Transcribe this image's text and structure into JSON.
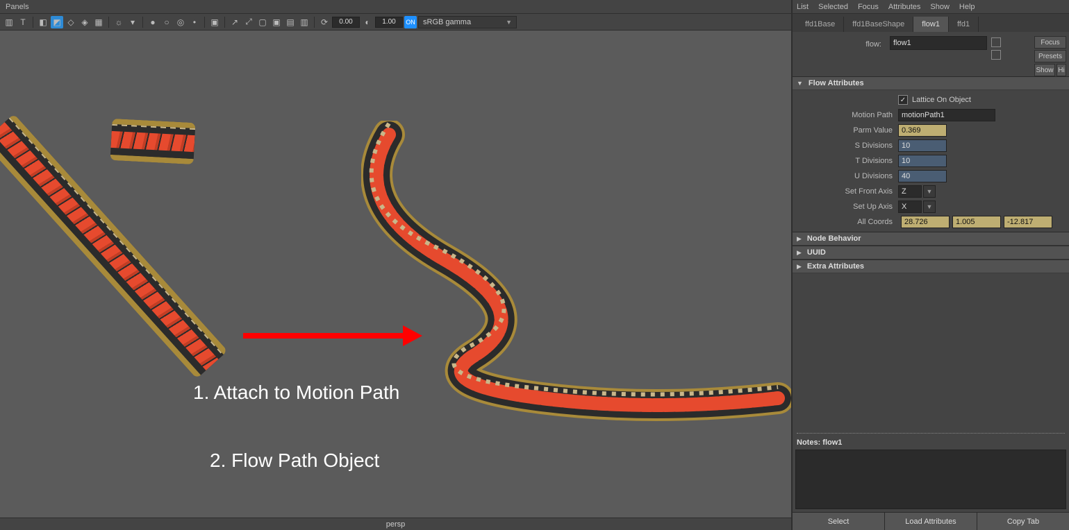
{
  "viewport": {
    "menu_label": "Panels",
    "num1": "0.00",
    "num2": "1.00",
    "on_label": "ON",
    "color_space": "sRGB gamma",
    "camera": "persp",
    "annotations": {
      "line1": "1. Attach to Motion Path",
      "line2": "2. Flow Path Object"
    }
  },
  "attr": {
    "menus": [
      "List",
      "Selected",
      "Focus",
      "Attributes",
      "Show",
      "Help"
    ],
    "tabs": {
      "items": [
        "ffd1Base",
        "ffd1BaseShape",
        "flow1",
        "ffd1"
      ],
      "active": "flow1"
    },
    "header": {
      "label": "flow:",
      "value": "flow1",
      "btn_focus": "Focus",
      "btn_presets": "Presets",
      "btn_show": "Show",
      "btn_hide": "Hi"
    },
    "flow_attributes": {
      "title": "Flow Attributes",
      "lattice_label": "Lattice On Object",
      "lattice_checked": "✓",
      "motion_path_label": "Motion Path",
      "motion_path_value": "motionPath1",
      "parm_value_label": "Parm Value",
      "parm_value": "0.369",
      "s_div_label": "S Divisions",
      "s_div": "10",
      "t_div_label": "T Divisions",
      "t_div": "10",
      "u_div_label": "U Divisions",
      "u_div": "40",
      "front_axis_label": "Set Front Axis",
      "front_axis": "Z",
      "up_axis_label": "Set Up Axis",
      "up_axis": "X",
      "all_coords_label": "All Coords",
      "coord_x": "28.726",
      "coord_y": "1.005",
      "coord_z": "-12.817"
    },
    "collapsed_sections": [
      "Node Behavior",
      "UUID",
      "Extra Attributes"
    ],
    "notes_label": "Notes:  flow1",
    "bottom_buttons": [
      "Select",
      "Load Attributes",
      "Copy Tab"
    ]
  }
}
